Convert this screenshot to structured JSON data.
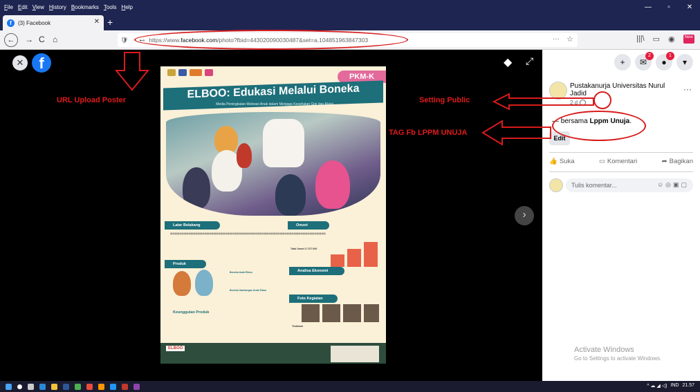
{
  "menu": [
    "File",
    "Edit",
    "View",
    "History",
    "Bookmarks",
    "Tools",
    "Help"
  ],
  "window_controls": {
    "minimize": "—",
    "restore": "▫",
    "close": "✕"
  },
  "tab": {
    "title": "(3) Facebook",
    "close": "✕",
    "new_tab": "+"
  },
  "nav": {
    "back": "←",
    "forward": "→",
    "reload": "C",
    "home": "⌂",
    "shield": "🛡",
    "key": "⊷",
    "url_prefix": "https://www.",
    "url_domain": "facebook.com",
    "url_rest": "/photo?fbid=443020090030487&set=a.104851963847303",
    "page_actions": "···",
    "star": "☆"
  },
  "toolbar_icons": [
    "|||\\",
    "▭",
    "◉",
    "New"
  ],
  "viewer": {
    "close": "✕",
    "logo": "f",
    "tag": "◆",
    "expand": "⤢",
    "next": "›"
  },
  "poster": {
    "badge": "PKM-K",
    "title": "ELBOO: Edukasi Melalui Boneka",
    "subtitle": "Media Peningkatan Motivasi Anak dalam Menjaga Kesehatan Gigi dan Mulut",
    "sections": [
      "Latar Belakang",
      "Omzet",
      "Produk",
      "Analisa Ekonomi",
      "Keunggulan Produk",
      "Foto Kegiatan",
      "Testimoni"
    ],
    "omzet_total": "Total Omzet 17.377.000",
    "product_1": "Boneka Anak Elboo",
    "product_2": "Boneka Gambargan Anak Elboo",
    "footer_logo": "ELBOO"
  },
  "panel": {
    "add": "+",
    "messenger": "✉",
    "messenger_badge": "2",
    "notifications": "●",
    "notifications_badge": "1",
    "account": "▾",
    "page_name": "Pustakanurja Universitas Nurul Jadid",
    "meta": "2 d",
    "more": "···",
    "caption_prefix": "— bersama ",
    "caption_tag": "Lppm Unuja",
    "caption_suffix": ".",
    "edit": "Edit",
    "like": "Suka",
    "comment": "Komentari",
    "share": "Bagikan",
    "like_icon": "👍",
    "comment_icon": "▭",
    "share_icon": "➦",
    "comment_placeholder": "Tulis komentar...",
    "comment_icons": "☺◎▣▢"
  },
  "watermark": {
    "line1": "Activate Windows",
    "line2": "Go to Settings to activate Windows."
  },
  "annotations": {
    "url": "URL Upload Poster",
    "public": "Setting Public",
    "tag": "TAG Fb LPPM UNUJA"
  },
  "taskbar": {
    "time": "21.57",
    "lang": "IND",
    "tray_icons": "^ ☁ ◢ ◁)"
  },
  "colors": {
    "facebook_blue": "#1877f2",
    "annotation_red": "#e01b1b",
    "poster_teal": "#1d6f7a",
    "chrome_dark": "#1e2551"
  }
}
